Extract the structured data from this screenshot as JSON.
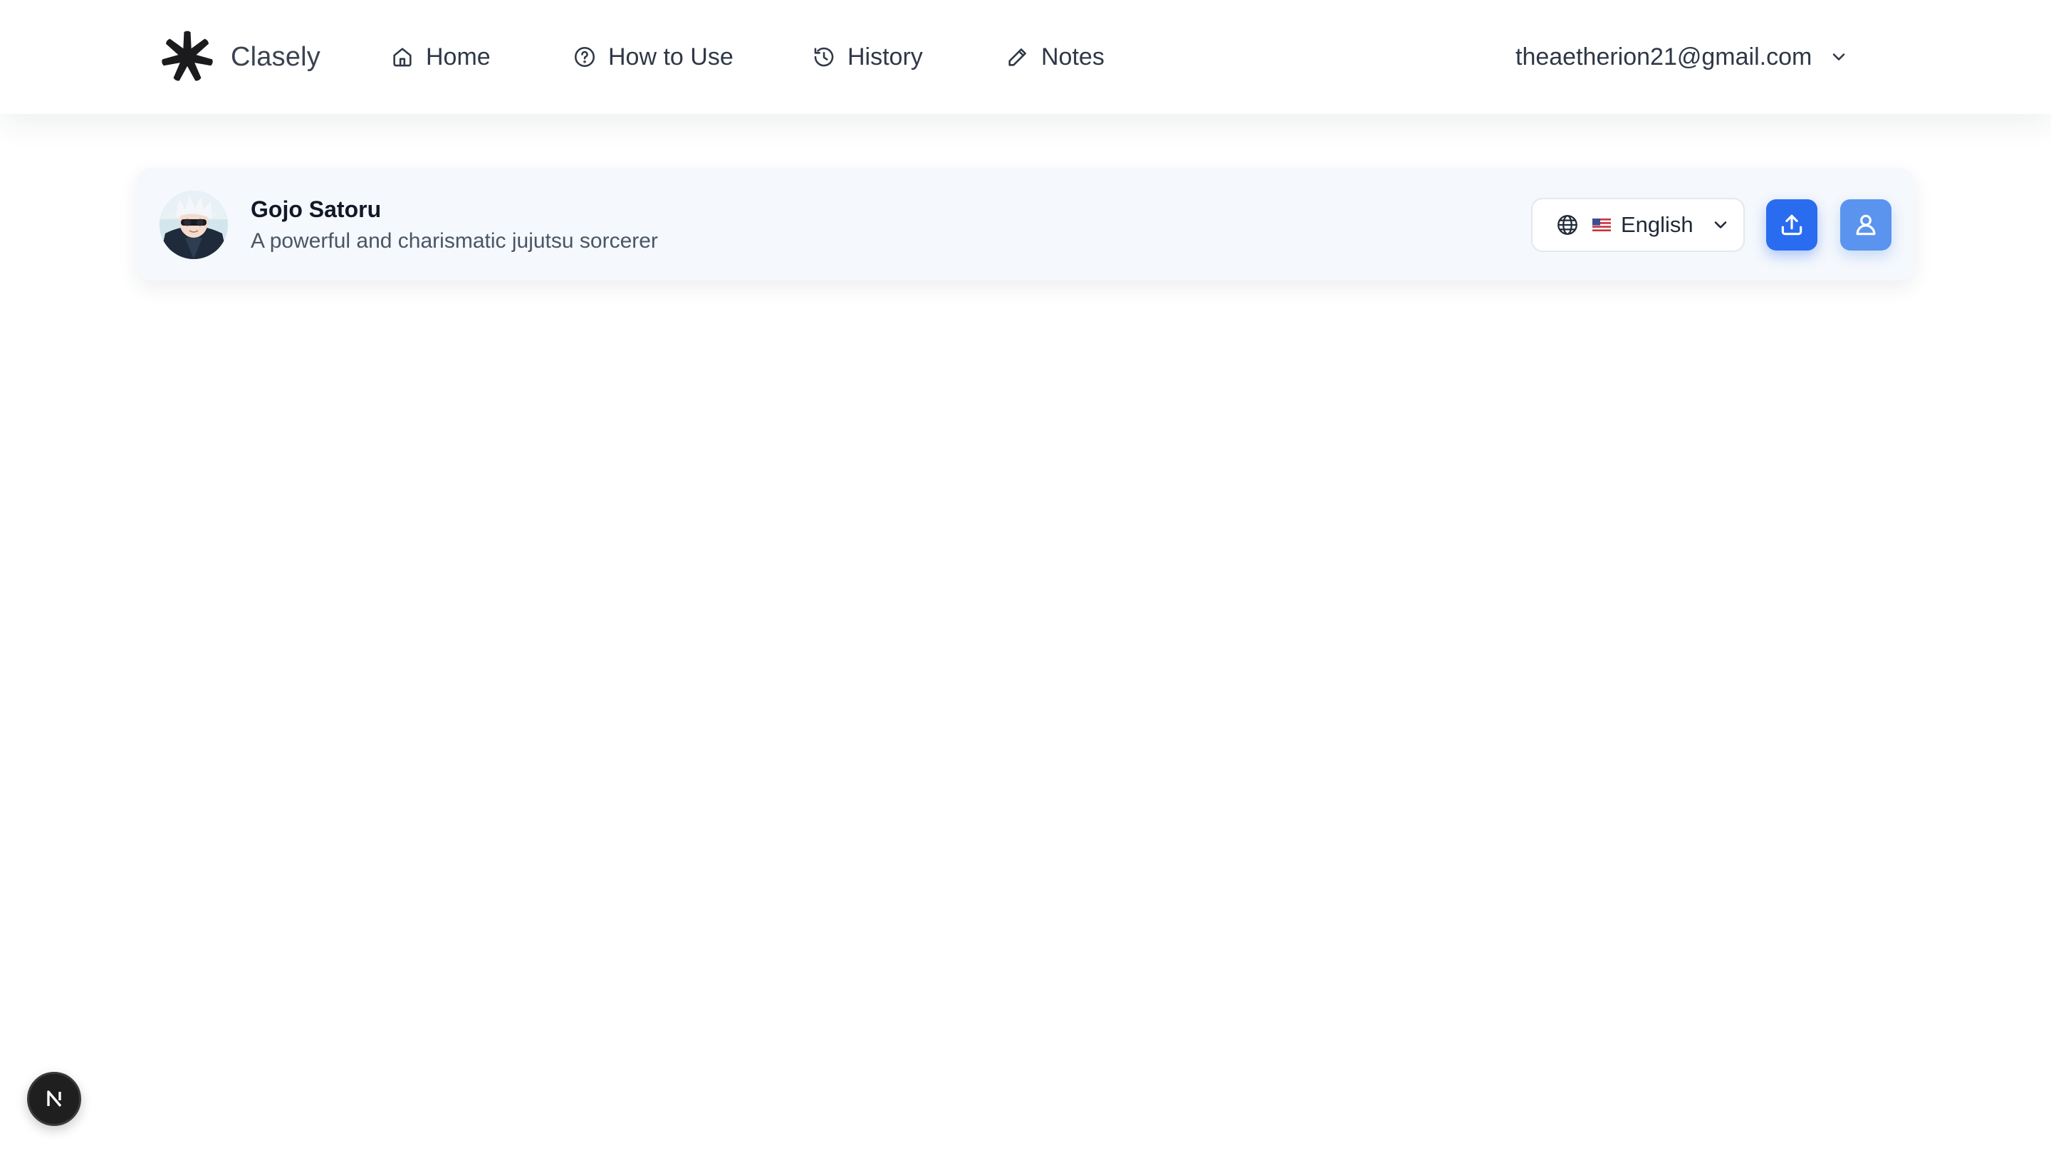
{
  "header": {
    "brand": {
      "name": "Clasely",
      "icon": "asterisk-logo-icon"
    },
    "nav": [
      {
        "label": "Home",
        "icon": "home-icon"
      },
      {
        "label": "How to Use",
        "icon": "help-circle-icon"
      },
      {
        "label": "History",
        "icon": "history-icon"
      },
      {
        "label": "Notes",
        "icon": "pencil-icon"
      }
    ],
    "account": {
      "email": "theaetherion21@gmail.com",
      "icon": "chevron-down-icon"
    }
  },
  "character": {
    "name": "Gojo Satoru",
    "description": "A powerful and charismatic jujutsu sorcerer",
    "avatar_icon": "character-avatar",
    "language": {
      "selected": "English",
      "flag": "us-flag-icon",
      "icon": "globe-icon"
    },
    "actions": [
      {
        "icon": "upload-icon",
        "color": "#2a6cf0"
      },
      {
        "icon": "user-icon",
        "color": "#5b94ee"
      }
    ]
  },
  "dev_badge": {
    "letter": "N",
    "icon": "nextjs-logo-icon"
  },
  "colors": {
    "primary": "#2a6cf0",
    "secondary": "#5b94ee",
    "card_bg": "#f5f8fc",
    "text_dark": "#111827"
  }
}
